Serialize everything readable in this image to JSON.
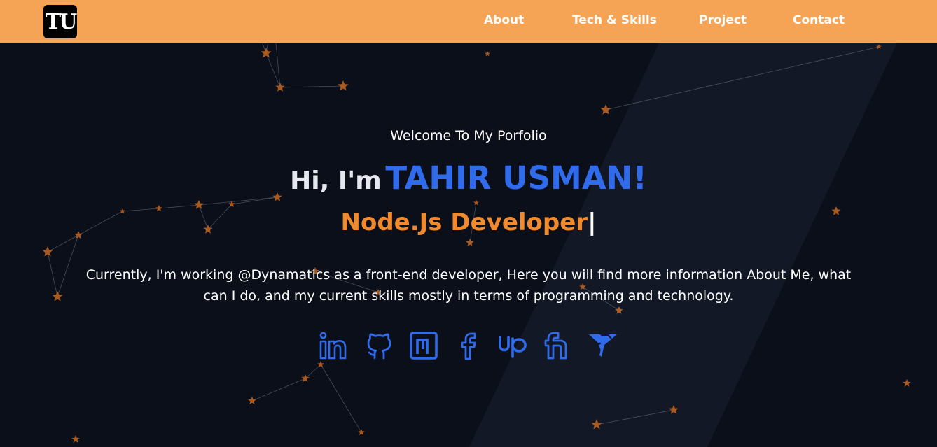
{
  "logo": {
    "text": "TU"
  },
  "nav": {
    "items": [
      {
        "label": "About"
      },
      {
        "label": "Tech & Skills"
      },
      {
        "label": "Project"
      },
      {
        "label": "Contact"
      }
    ]
  },
  "hero": {
    "welcome": "Welcome To My Porfolio",
    "greeting": "Hi, I'm",
    "name": "TAHIR USMAN!",
    "role": "Node.Js Developer",
    "cursor": "|",
    "intro": "Currently, I'm working @Dynamatics as a front-end developer, Here you will find more information About Me, what can I do, and my current skills mostly in terms of programming and technology."
  },
  "socials": [
    {
      "icon": "linkedin-icon"
    },
    {
      "icon": "github-icon"
    },
    {
      "icon": "netlify-icon"
    },
    {
      "icon": "facebook-icon"
    },
    {
      "icon": "upwork-icon"
    },
    {
      "icon": "fiverr-icon"
    },
    {
      "icon": "freelancer-icon"
    }
  ],
  "colors": {
    "navbar": "#f5a455",
    "background": "#0b0f19",
    "accent_blue": "#2f6bea",
    "accent_orange": "#f08a2c",
    "star": "#a85a21"
  }
}
